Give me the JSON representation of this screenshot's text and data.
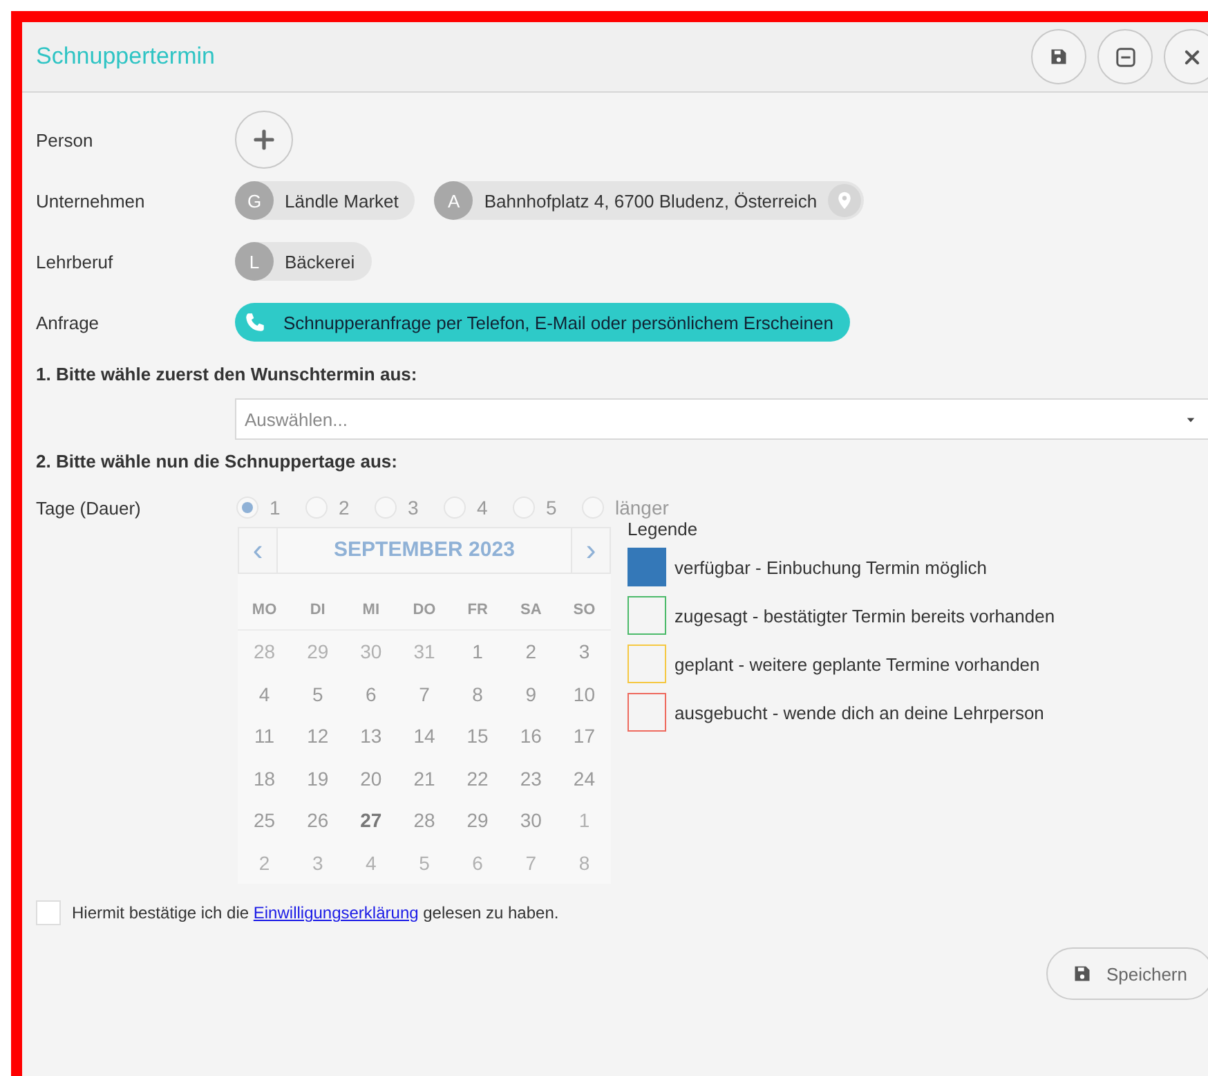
{
  "window": {
    "title": "Schnuppertermin",
    "buttons": [
      {
        "kind": "save"
      },
      {
        "kind": "minimize"
      },
      {
        "kind": "close"
      }
    ]
  },
  "fields": [
    {
      "label": "Person",
      "kind": "add"
    },
    {
      "label": "Unternehmen",
      "kind": "chips",
      "chips": [
        {
          "initial": "G",
          "text": "Ländle Market",
          "pin": false
        },
        {
          "initial": "A",
          "text": "Bahnhofplatz 4, 6700 Bludenz, Österreich",
          "pin": true
        }
      ]
    },
    {
      "label": "Lehrberuf",
      "kind": "chips",
      "chips": [
        {
          "initial": "L",
          "text": "Bäckerei",
          "pin": false
        }
      ]
    },
    {
      "label": "Anfrage",
      "kind": "request",
      "text": "Schnupperanfrage per Telefon, E-Mail oder persönlichem Erscheinen"
    }
  ],
  "step1": {
    "heading": "1. Bitte wähle zuerst den Wunschtermin aus:",
    "select": {
      "placeholder": "Auswählen..."
    }
  },
  "step2": {
    "heading": "2. Bitte wähle nun die Schnuppertage aus:",
    "label": "Tage (Dauer)",
    "options": [
      {
        "label": "1",
        "selected": true
      },
      {
        "label": "2",
        "selected": false
      },
      {
        "label": "3",
        "selected": false
      },
      {
        "label": "4",
        "selected": false
      },
      {
        "label": "5",
        "selected": false
      },
      {
        "label": "länger",
        "selected": false
      }
    ]
  },
  "calendar": {
    "title": "SEPTEMBER 2023",
    "prev": "‹",
    "next": "›",
    "weekdays": [
      "MO",
      "DI",
      "MI",
      "DO",
      "FR",
      "SA",
      "SO"
    ],
    "weeks": [
      [
        {
          "day": "28",
          "outside": true,
          "today": false
        },
        {
          "day": "29",
          "outside": true,
          "today": false
        },
        {
          "day": "30",
          "outside": true,
          "today": false
        },
        {
          "day": "31",
          "outside": true,
          "today": false
        },
        {
          "day": "1",
          "outside": false,
          "today": false
        },
        {
          "day": "2",
          "outside": false,
          "today": false
        },
        {
          "day": "3",
          "outside": false,
          "today": false
        }
      ],
      [
        {
          "day": "4",
          "outside": false,
          "today": false
        },
        {
          "day": "5",
          "outside": false,
          "today": false
        },
        {
          "day": "6",
          "outside": false,
          "today": false
        },
        {
          "day": "7",
          "outside": false,
          "today": false
        },
        {
          "day": "8",
          "outside": false,
          "today": false
        },
        {
          "day": "9",
          "outside": false,
          "today": false
        },
        {
          "day": "10",
          "outside": false,
          "today": false
        }
      ],
      [
        {
          "day": "11",
          "outside": false,
          "today": false
        },
        {
          "day": "12",
          "outside": false,
          "today": false
        },
        {
          "day": "13",
          "outside": false,
          "today": false
        },
        {
          "day": "14",
          "outside": false,
          "today": false
        },
        {
          "day": "15",
          "outside": false,
          "today": false
        },
        {
          "day": "16",
          "outside": false,
          "today": false
        },
        {
          "day": "17",
          "outside": false,
          "today": false
        }
      ],
      [
        {
          "day": "18",
          "outside": false,
          "today": false
        },
        {
          "day": "19",
          "outside": false,
          "today": false
        },
        {
          "day": "20",
          "outside": false,
          "today": false
        },
        {
          "day": "21",
          "outside": false,
          "today": false
        },
        {
          "day": "22",
          "outside": false,
          "today": false
        },
        {
          "day": "23",
          "outside": false,
          "today": false
        },
        {
          "day": "24",
          "outside": false,
          "today": false
        }
      ],
      [
        {
          "day": "25",
          "outside": false,
          "today": false
        },
        {
          "day": "26",
          "outside": false,
          "today": false
        },
        {
          "day": "27",
          "outside": false,
          "today": true
        },
        {
          "day": "28",
          "outside": false,
          "today": false
        },
        {
          "day": "29",
          "outside": false,
          "today": false
        },
        {
          "day": "30",
          "outside": false,
          "today": false
        },
        {
          "day": "1",
          "outside": true,
          "today": false
        }
      ],
      [
        {
          "day": "2",
          "outside": true,
          "today": false
        },
        {
          "day": "3",
          "outside": true,
          "today": false
        },
        {
          "day": "4",
          "outside": true,
          "today": false
        },
        {
          "day": "5",
          "outside": true,
          "today": false
        },
        {
          "day": "6",
          "outside": true,
          "today": false
        },
        {
          "day": "7",
          "outside": true,
          "today": false
        },
        {
          "day": "8",
          "outside": true,
          "today": false
        }
      ]
    ]
  },
  "legend": {
    "title": "Legende",
    "items": [
      {
        "text": "verfügbar - Einbuchung Termin möglich",
        "color": "#3478b8",
        "filled": true
      },
      {
        "text": "zugesagt - bestätigter Termin bereits vorhanden",
        "color": "#4cba6a",
        "filled": false
      },
      {
        "text": "geplant - weitere geplante Termine vorhanden",
        "color": "#f5c842",
        "filled": false
      },
      {
        "text": "ausgebucht - wende dich an deine Lehrperson",
        "color": "#ee6a5e",
        "filled": false
      }
    ]
  },
  "consent": {
    "checked": false,
    "before": "Hiermit bestätige ich die",
    "link": "Einwilligungserklärung",
    "after": "gelesen zu haben."
  },
  "save_button": {
    "label": "Speichern"
  }
}
